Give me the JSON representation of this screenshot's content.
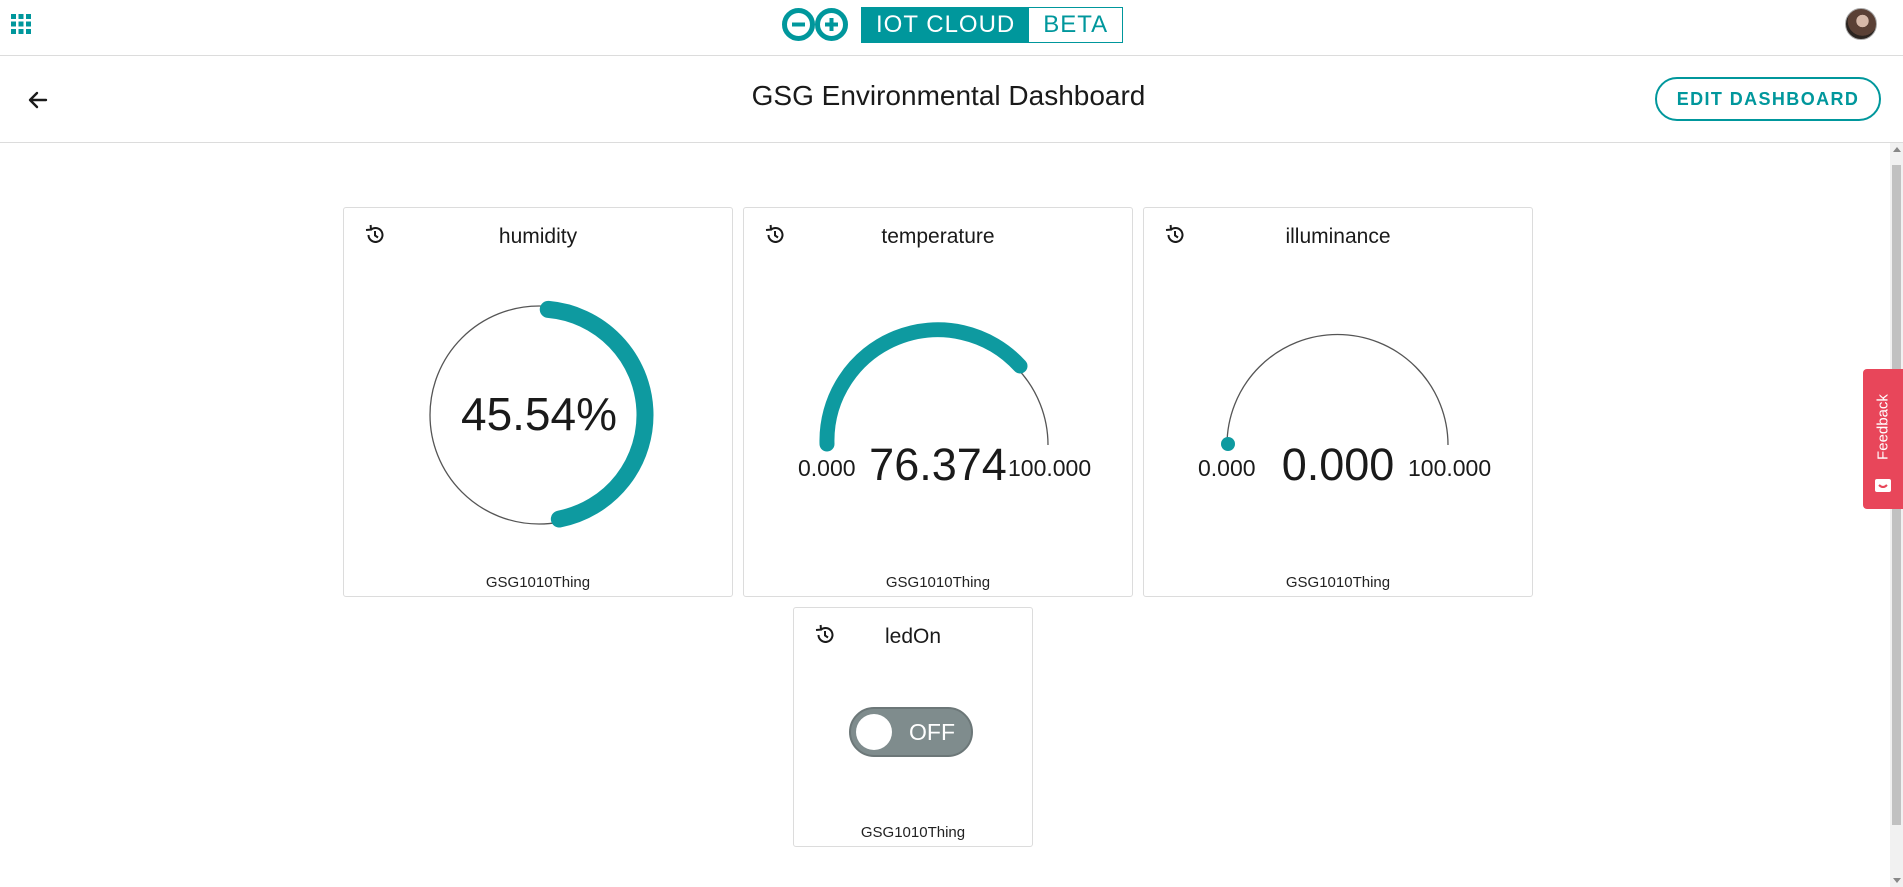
{
  "app": {
    "brand_main": "IOT CLOUD",
    "brand_badge": "BETA",
    "accent_color": "#00979c"
  },
  "topbar": {
    "apps_icon": "grid-apps-icon",
    "avatar_icon": "user-avatar"
  },
  "header": {
    "title": "GSG Environmental Dashboard",
    "edit_label": "EDIT DASHBOARD",
    "back_icon": "arrow-left-icon"
  },
  "feedback": {
    "label": "Feedback",
    "color": "#e8465a"
  },
  "widgets": {
    "humidity": {
      "title": "humidity",
      "value": "45.54%",
      "percent": 45.54,
      "thing": "GSG1010Thing"
    },
    "temperature": {
      "title": "temperature",
      "value": "76.374",
      "min": "0.000",
      "max": "100.000",
      "thing": "GSG1010Thing"
    },
    "illuminance": {
      "title": "illuminance",
      "value": "0.000",
      "min": "0.000",
      "max": "100.000",
      "thing": "GSG1010Thing"
    },
    "ledOn": {
      "title": "ledOn",
      "state": "OFF",
      "thing": "GSG1010Thing"
    }
  }
}
